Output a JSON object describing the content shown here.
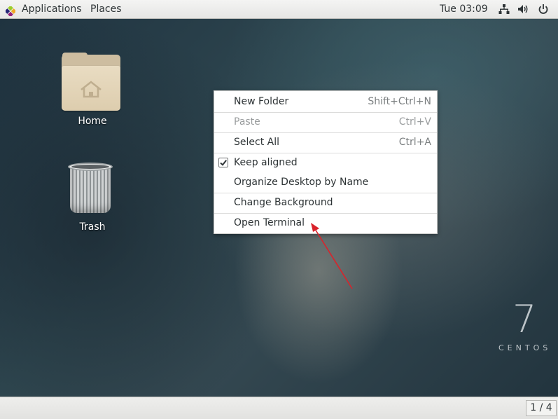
{
  "topbar": {
    "applications_label": "Applications",
    "places_label": "Places",
    "clock": "Tue 03:09",
    "icons": [
      "network-icon",
      "volume-icon",
      "power-icon"
    ]
  },
  "desktop": {
    "icons": [
      {
        "label": "Home",
        "icon": "home-folder-icon"
      },
      {
        "label": "Trash",
        "icon": "trash-icon"
      }
    ],
    "logo": {
      "number": "7",
      "word": "CENTOS"
    }
  },
  "context_menu": {
    "items": [
      {
        "label": "New Folder",
        "accel": "Shift+Ctrl+N",
        "enabled": true
      },
      {
        "label": "Paste",
        "accel": "Ctrl+V",
        "enabled": false
      },
      {
        "label": "Select All",
        "accel": "Ctrl+A",
        "enabled": true
      },
      {
        "label": "Keep aligned",
        "accel": "",
        "enabled": true,
        "checked": true
      },
      {
        "label": "Organize Desktop by Name",
        "accel": "",
        "enabled": true
      },
      {
        "label": "Change Background",
        "accel": "",
        "enabled": true
      },
      {
        "label": "Open Terminal",
        "accel": "",
        "enabled": true
      }
    ]
  },
  "bottombar": {
    "workspace_indicator": "1 / 4"
  },
  "colors": {
    "annotation_arrow": "#d9232b",
    "topbar_bg": "#efefed",
    "menu_bg": "#ffffff"
  }
}
